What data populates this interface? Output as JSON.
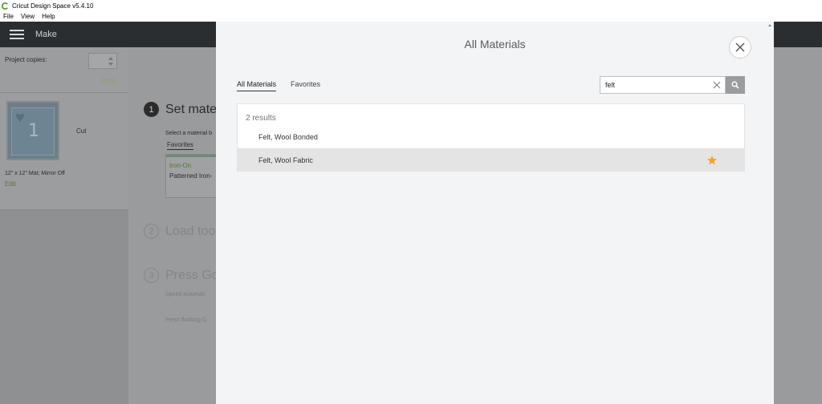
{
  "window": {
    "title": "Cricut Design Space  v5.4.10",
    "menu": [
      "File",
      "View",
      "Help"
    ]
  },
  "appbar": {
    "title": "Make"
  },
  "left_panel": {
    "project_copies_label": "Project copies:",
    "apply_label": "Apply",
    "mat_number": "1",
    "cut_label": "Cut",
    "mat_description": "12\" x 12\" Mat; Mirror Off",
    "edit_label": "Edit"
  },
  "steps": [
    {
      "number": "1",
      "title": "Set mater"
    },
    {
      "number": "2",
      "title": "Load too"
    },
    {
      "number": "3",
      "title": "Press Go"
    }
  ],
  "step1": {
    "hint": "Select a material b",
    "favorites_tab": "Favorites",
    "material_category": "Iron-On",
    "material_name": "Patterned Iron-"
  },
  "step3": {
    "line1": "Speed automati",
    "line2": "Press flashing G"
  },
  "modal": {
    "title": "All Materials",
    "tabs": [
      {
        "label": "All Materials",
        "active": true
      },
      {
        "label": "Favorites",
        "active": false
      }
    ],
    "search": {
      "value": "felt"
    },
    "results_count": "2 results",
    "results": [
      {
        "name": "Felt, Wool Bonded",
        "favorite": false,
        "highlighted": false
      },
      {
        "name": "Felt, Wool Fabric",
        "favorite": true,
        "highlighted": true
      }
    ]
  },
  "colors": {
    "accent_green": "#5d7a36",
    "favorite_star": "#f4a521",
    "appbar": "#2b2e31"
  }
}
